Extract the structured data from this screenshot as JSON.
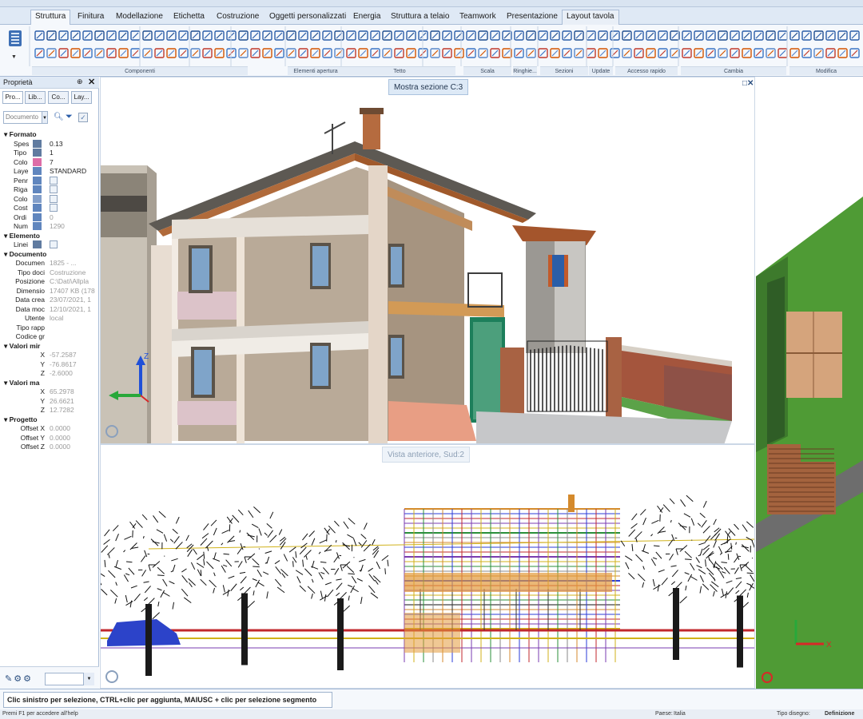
{
  "app": {
    "title_bar": ""
  },
  "tabs": [
    "Struttura",
    "Finitura",
    "Modellazione",
    "Etichetta",
    "Costruzione",
    "Oggetti personalizzati",
    "Energia",
    "Struttura a telaio",
    "Teamwork",
    "Presentazione",
    "Layout tavola"
  ],
  "active_tab": "Struttura",
  "ribbon_groups": [
    "Componenti",
    "Elementi apertura",
    "Tetto",
    "Scala",
    "Ringhie...",
    "Sezioni",
    "Update",
    "Accesso rapido",
    "Cambia",
    "Modifica"
  ],
  "panel": {
    "title": "Proprietà",
    "pin": "⊕",
    "close": "✕",
    "tabs": [
      "Pro...",
      "Lib...",
      "Co...",
      "Lay..."
    ],
    "doc_select": "Documento",
    "sections": {
      "formato": "Formato",
      "elemento": "Elemento",
      "documento": "Documento",
      "valori_min": "Valori mir",
      "valori_max": "Valori ma",
      "progetto": "Progetto"
    },
    "formato_rows": [
      {
        "label": "Spes",
        "value": "0.13"
      },
      {
        "label": "Tipo",
        "value": "1"
      },
      {
        "label": "Colo",
        "value": "7"
      },
      {
        "label": "Laye",
        "value": "STANDARD"
      },
      {
        "label": "Penr",
        "value": ""
      },
      {
        "label": "Riga",
        "value": ""
      },
      {
        "label": "Colo",
        "value": ""
      },
      {
        "label": "Cost",
        "value": ""
      },
      {
        "label": "Ordi",
        "value": "0"
      },
      {
        "label": "Num",
        "value": "1290"
      }
    ],
    "elemento_rows": [
      {
        "label": "Linei",
        "value": ""
      }
    ],
    "documento_rows": [
      {
        "label": "Documen",
        "value": "1825 - ..."
      },
      {
        "label": "Tipo doci",
        "value": "Costruzione"
      },
      {
        "label": "Posizione",
        "value": "C:\\Dati\\Allpla"
      },
      {
        "label": "Dimensio",
        "value": "17407 KB (178"
      },
      {
        "label": "Data crea",
        "value": "23/07/2021, 1"
      },
      {
        "label": "Data moc",
        "value": "12/10/2021, 1"
      },
      {
        "label": "Utente",
        "value": "local"
      },
      {
        "label": "Tipo rapp",
        "value": ""
      },
      {
        "label": "Codice gr",
        "value": ""
      }
    ],
    "min_rows": [
      {
        "label": "X",
        "value": "-57.2587"
      },
      {
        "label": "Y",
        "value": "-76.8617"
      },
      {
        "label": "Z",
        "value": "-2.6000"
      }
    ],
    "max_rows": [
      {
        "label": "X",
        "value": "65.2978"
      },
      {
        "label": "Y",
        "value": "26.6621"
      },
      {
        "label": "Z",
        "value": "12.7282"
      }
    ],
    "progetto_rows": [
      {
        "label": "Offset X",
        "value": "0.0000"
      },
      {
        "label": "Offset Y",
        "value": "0.0000"
      },
      {
        "label": "Offset Z",
        "value": "0.0000"
      }
    ]
  },
  "views": {
    "view3d_tag": "Mostra sezione C:3",
    "front_tag": "Vista anteriore, Sud:2",
    "view_ctl": "□✕"
  },
  "status": {
    "hint": "Clic sinistro per selezione, CTRL+clic per aggiunta, MAIUSC + clic per selezione segmento",
    "help": "Premi F1 per accedere all'help",
    "country_label": "Paese:",
    "country": "Italia",
    "drawing_type_label": "Tipo disegno:",
    "drawing_type": "Definizione"
  },
  "colors": {
    "ribbon_bg": "#f5f8fc",
    "accent": "#2b5da8",
    "plaster": "#b9aa98",
    "roof": "#b06a3a",
    "grass": "#4f9b35"
  }
}
